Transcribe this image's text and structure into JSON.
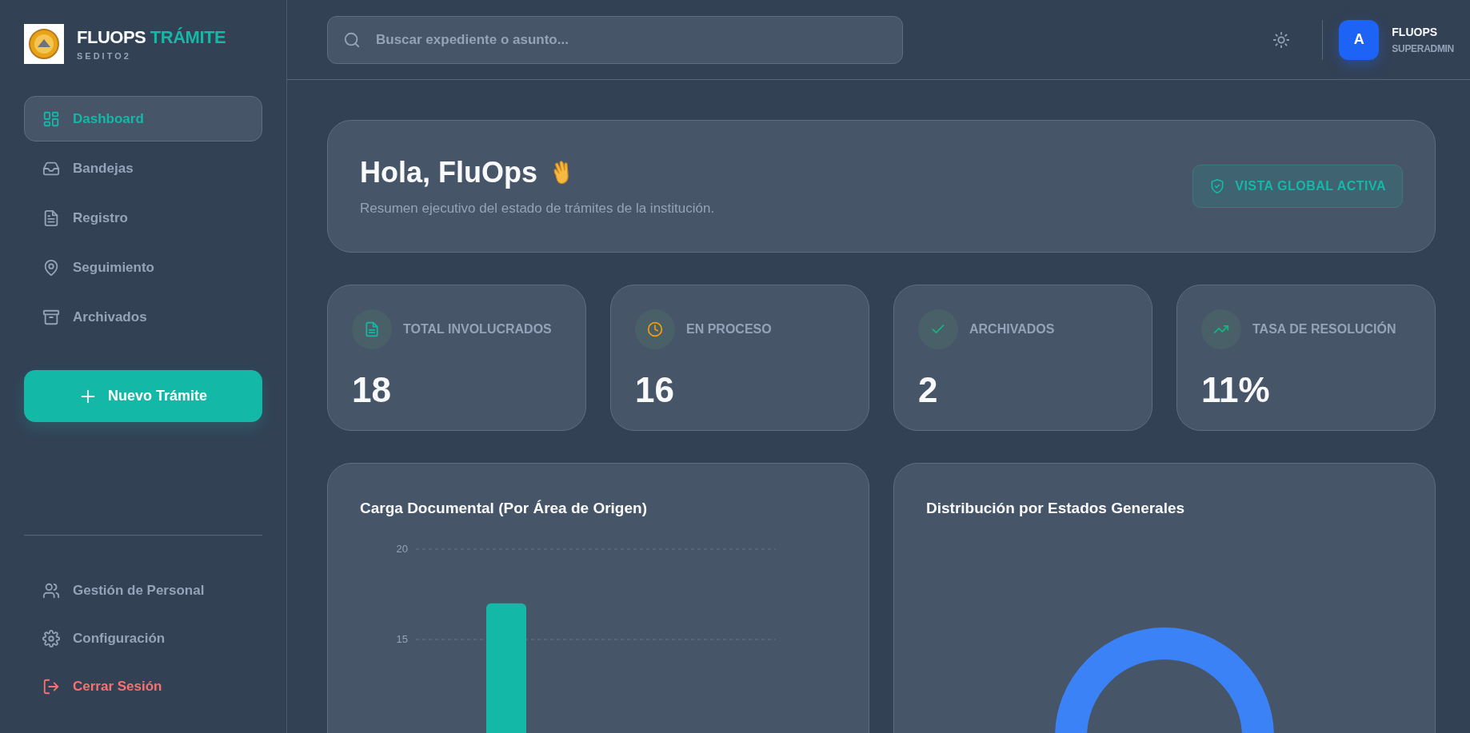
{
  "sidebar": {
    "brand": {
      "name": "FLUOPS",
      "highlight": "TRÁMITE",
      "subtitle": "SEDITO2"
    },
    "nav": [
      {
        "label": "Dashboard",
        "selected": true
      },
      {
        "label": "Bandejas",
        "selected": false
      },
      {
        "label": "Registro",
        "selected": false
      },
      {
        "label": "Seguimiento",
        "selected": false
      },
      {
        "label": "Archivados",
        "selected": false
      }
    ],
    "new_button": "Nuevo Trámite",
    "footer": [
      {
        "label": "Gestión de Personal",
        "kind": "normal"
      },
      {
        "label": "Configuración",
        "kind": "normal"
      },
      {
        "label": "Cerrar Sesión",
        "kind": "danger"
      }
    ]
  },
  "header": {
    "search": {
      "placeholder": "Buscar expediente o asunto..."
    },
    "user": {
      "initial": "A",
      "name": "FLUOPS",
      "role": "SUPERADMIN"
    }
  },
  "hero": {
    "title": "Hola, FluOps",
    "subtitle": "Resumen ejecutivo del estado de trámites de la institución.",
    "badge": "VISTA GLOBAL ACTIVA"
  },
  "stats": [
    {
      "label": "TOTAL INVOLUCRADOS",
      "value": "18",
      "color": "#14b8a6"
    },
    {
      "label": "EN PROCESO",
      "value": "16",
      "color": "#f59e0b"
    },
    {
      "label": "ARCHIVADOS",
      "value": "2",
      "color": "#10b981"
    },
    {
      "label": "TASA DE RESOLUCIÓN",
      "value": "11%",
      "color": "#10b981"
    }
  ],
  "charts": [
    {
      "title": "Carga Documental (Por Área de Origen)",
      "chart_data": {
        "type": "bar",
        "values": [
          17
        ],
        "ylim": [
          0,
          20
        ],
        "yticks": [
          15,
          20
        ]
      }
    },
    {
      "title": "Distribución por Estados Generales"
    }
  ]
}
